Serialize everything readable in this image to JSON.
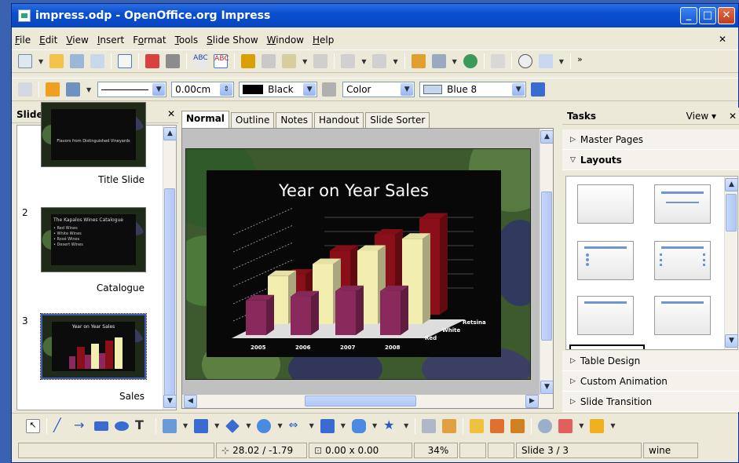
{
  "window": {
    "title": "impress.odp - OpenOffice.org Impress"
  },
  "menu": [
    "File",
    "Edit",
    "View",
    "Insert",
    "Format",
    "Tools",
    "Slide Show",
    "Window",
    "Help"
  ],
  "menu_mnemonics": [
    "F",
    "E",
    "V",
    "I",
    "o",
    "T",
    "S",
    "W",
    "H"
  ],
  "line_toolbar": {
    "width_value": "0.00cm",
    "color_value": "Black",
    "area_style": "Color",
    "area_color": "Blue 8"
  },
  "slides_pane": {
    "title": "Slides",
    "items": [
      {
        "number": "",
        "label": "Title Slide",
        "heading": "Flavors from Distinguished Vineyards"
      },
      {
        "number": "2",
        "label": "Catalogue",
        "heading": "The Kapalos Wines Catalogue",
        "bullets": [
          "Red Wines",
          "White Wines",
          "Rosé Wines",
          "Desert Wines"
        ]
      },
      {
        "number": "3",
        "label": "Sales",
        "heading": "Year on Year Sales"
      }
    ]
  },
  "view_tabs": [
    "Normal",
    "Outline",
    "Notes",
    "Handout",
    "Slide Sorter"
  ],
  "slide": {
    "title": "Year on Year Sales"
  },
  "chart_data": {
    "type": "bar",
    "title": "Year on Year Sales",
    "categories": [
      "2005",
      "2006",
      "2007",
      "2008"
    ],
    "series": [
      {
        "name": "Red",
        "values": [
          3.0,
          4.8,
          6.0,
          7.2
        ],
        "color": "#8a0f18"
      },
      {
        "name": "White",
        "values": [
          3.6,
          4.5,
          5.5,
          6.4
        ],
        "color": "#f2eeb0"
      },
      {
        "name": "Retsina",
        "values": [
          2.6,
          2.9,
          3.3,
          3.3
        ],
        "color": "#8a2a5c"
      }
    ],
    "xlabel": "",
    "ylabel": "",
    "legend": "inline"
  },
  "tasks_pane": {
    "title": "Tasks",
    "view_label": "View",
    "sections": {
      "master": "Master Pages",
      "layouts": "Layouts",
      "table": "Table Design",
      "animation": "Custom Animation",
      "transition": "Slide Transition"
    }
  },
  "status": {
    "position": "28.02 / -1.79",
    "size": "0.00 x 0.00",
    "zoom": "34%",
    "slide": "Slide 3 / 3",
    "master": "wine"
  }
}
